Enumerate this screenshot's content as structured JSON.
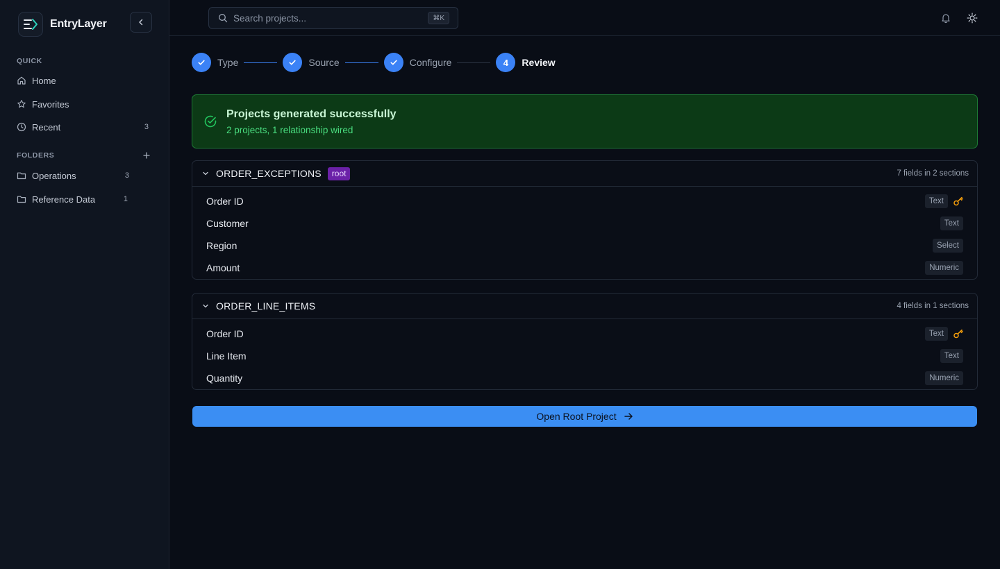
{
  "app": {
    "brand": "EntryLayer"
  },
  "sidebar": {
    "quick_label": "QUICK",
    "quick_items": [
      {
        "label": "Home",
        "icon": "home-icon",
        "count": ""
      },
      {
        "label": "Favorites",
        "icon": "star-icon",
        "count": ""
      },
      {
        "label": "Recent",
        "icon": "clock-icon",
        "count": "3"
      }
    ],
    "folders_label": "FOLDERS",
    "folders": [
      {
        "label": "Operations",
        "icon": "folder-icon",
        "count": "3"
      },
      {
        "label": "Reference Data",
        "icon": "folder-icon",
        "count": "1"
      }
    ]
  },
  "topbar": {
    "search_placeholder": "Search projects...",
    "shortcut": "⌘K"
  },
  "stepper": {
    "steps": [
      {
        "label": "Type",
        "state": "done",
        "number": "1"
      },
      {
        "label": "Source",
        "state": "done",
        "number": "2"
      },
      {
        "label": "Configure",
        "state": "done",
        "number": "3"
      },
      {
        "label": "Review",
        "state": "active",
        "number": "4"
      }
    ]
  },
  "banner": {
    "title": "Projects generated successfully",
    "subtitle": "2 projects, 1 relationship wired"
  },
  "projects": [
    {
      "name": "ORDER_EXCEPTIONS",
      "badge": "root",
      "meta": "7 fields in 2 sections",
      "fields": [
        {
          "name": "Order ID",
          "type": "Text",
          "key": true
        },
        {
          "name": "Customer",
          "type": "Text",
          "key": false
        },
        {
          "name": "Region",
          "type": "Select",
          "key": false
        },
        {
          "name": "Amount",
          "type": "Numeric",
          "key": false
        }
      ]
    },
    {
      "name": "ORDER_LINE_ITEMS",
      "badge": "",
      "meta": "4 fields in 1 sections",
      "fields": [
        {
          "name": "Order ID",
          "type": "Text",
          "key": true
        },
        {
          "name": "Line Item",
          "type": "Text",
          "key": false
        },
        {
          "name": "Quantity",
          "type": "Numeric",
          "key": false
        }
      ]
    }
  ],
  "actions": {
    "open_root": "Open Root Project"
  },
  "colors": {
    "accent": "#3b82f6",
    "success_bg": "#0c3a16",
    "success_text": "#4ade80",
    "root_badge": "#6b21a8",
    "key_icon": "#f59e0b"
  }
}
